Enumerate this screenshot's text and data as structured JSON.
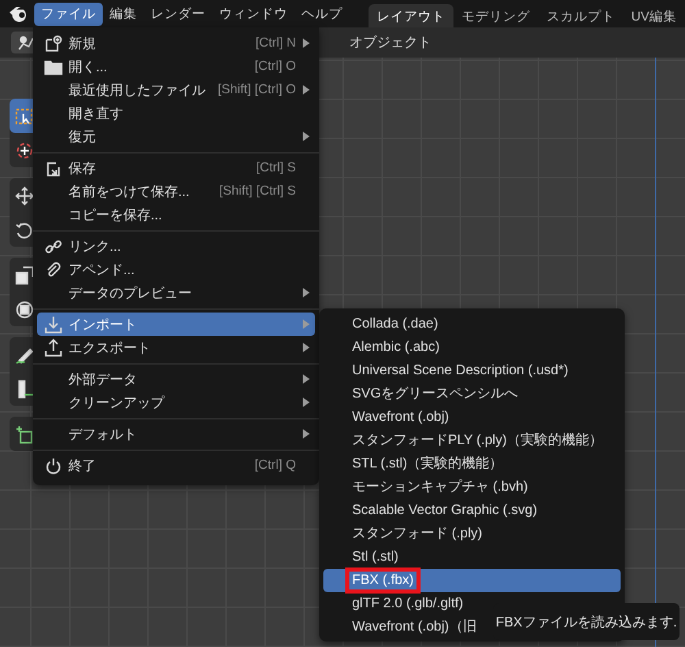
{
  "top_bar": {
    "menus": [
      {
        "label": "ファイル",
        "selected": true
      },
      {
        "label": "編集",
        "selected": false
      },
      {
        "label": "レンダー",
        "selected": false
      },
      {
        "label": "ウィンドウ",
        "selected": false
      },
      {
        "label": "ヘルプ",
        "selected": false
      }
    ],
    "workspace_tabs": [
      {
        "label": "レイアウト",
        "selected": true
      },
      {
        "label": "モデリング",
        "selected": false
      },
      {
        "label": "スカルプト",
        "selected": false
      },
      {
        "label": "UV編集",
        "selected": false
      }
    ]
  },
  "viewport": {
    "header_menu": "オブジェクト",
    "tool_groups": [
      [
        {
          "selected": true
        },
        {
          "selected": false
        }
      ],
      [
        {
          "selected": false
        },
        {
          "selected": false
        }
      ],
      [
        {
          "selected": false
        },
        {
          "selected": false
        }
      ],
      [
        {
          "selected": false
        },
        {
          "selected": false
        }
      ],
      [
        {
          "selected": false
        }
      ]
    ]
  },
  "file_menu": {
    "sections": [
      [
        {
          "label": "新規",
          "shortcut": "[Ctrl] N",
          "submenu": true,
          "selected": false
        },
        {
          "label": "開く...",
          "shortcut": "[Ctrl] O",
          "submenu": false,
          "selected": false
        },
        {
          "label": "最近使用したファイル",
          "shortcut": "[Shift] [Ctrl] O",
          "submenu": true,
          "selected": false
        },
        {
          "label": "開き直す",
          "submenu": false,
          "selected": false
        },
        {
          "label": "復元",
          "submenu": true,
          "selected": false
        }
      ],
      [
        {
          "label": "保存",
          "shortcut": "[Ctrl] S",
          "submenu": false,
          "selected": false
        },
        {
          "label": "名前をつけて保存...",
          "shortcut": "[Shift] [Ctrl] S",
          "submenu": false,
          "selected": false
        },
        {
          "label": "コピーを保存...",
          "submenu": false,
          "selected": false
        }
      ],
      [
        {
          "label": "リンク...",
          "submenu": false,
          "selected": false
        },
        {
          "label": "アペンド...",
          "submenu": false,
          "selected": false
        },
        {
          "label": "データのプレビュー",
          "submenu": true,
          "selected": false
        }
      ],
      [
        {
          "label": "インポート",
          "submenu": true,
          "selected": true
        },
        {
          "label": "エクスポート",
          "submenu": true,
          "selected": false
        }
      ],
      [
        {
          "label": "外部データ",
          "submenu": true,
          "selected": false
        },
        {
          "label": "クリーンアップ",
          "submenu": true,
          "selected": false
        }
      ],
      [
        {
          "label": "デフォルト",
          "submenu": true,
          "selected": false
        }
      ],
      [
        {
          "label": "終了",
          "shortcut": "[Ctrl] Q",
          "submenu": false,
          "selected": false
        }
      ]
    ]
  },
  "import_submenu": {
    "items": [
      {
        "label": "Collada (.dae)",
        "selected": false,
        "annotated": false
      },
      {
        "label": "Alembic (.abc)",
        "selected": false,
        "annotated": false
      },
      {
        "label": "Universal Scene Description (.usd*)",
        "selected": false,
        "annotated": false
      },
      {
        "label": "SVGをグリースペンシルへ",
        "selected": false,
        "annotated": false
      },
      {
        "label": "Wavefront (.obj)",
        "selected": false,
        "annotated": false
      },
      {
        "label": "スタンフォードPLY (.ply)（実験的機能）",
        "selected": false,
        "annotated": false
      },
      {
        "label": "STL (.stl)（実験的機能）",
        "selected": false,
        "annotated": false
      },
      {
        "label": "モーションキャプチャ (.bvh)",
        "selected": false,
        "annotated": false
      },
      {
        "label": "Scalable Vector Graphic (.svg)",
        "selected": false,
        "annotated": false
      },
      {
        "label": "スタンフォード (.ply)",
        "selected": false,
        "annotated": false
      },
      {
        "label": "Stl (.stl)",
        "selected": false,
        "annotated": false
      },
      {
        "label": "FBX (.fbx)",
        "selected": true,
        "annotated": true
      },
      {
        "label": "glTF 2.0 (.glb/.gltf)",
        "selected": false,
        "annotated": false
      },
      {
        "label": "Wavefront (.obj)（旧",
        "selected": false,
        "annotated": false
      }
    ]
  },
  "tooltip": {
    "text": "FBXファイルを読み込みます."
  }
}
